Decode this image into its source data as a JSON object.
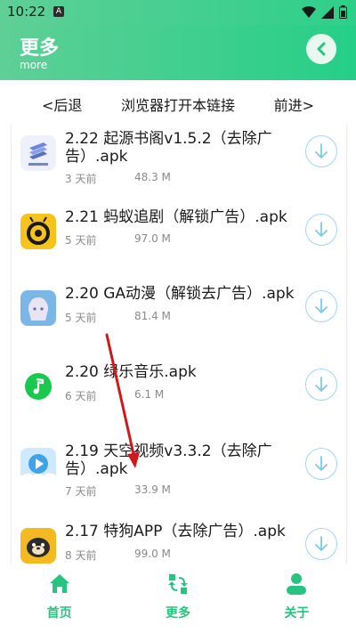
{
  "status_bar": {
    "time": "10:22",
    "notif_letter": "A"
  },
  "header": {
    "title": "更多",
    "subtitle": "more"
  },
  "browser_nav": {
    "back": "<后退",
    "open_link": "浏览器打开本链接",
    "forward": "前进>"
  },
  "apps": [
    {
      "title": "2.22 起源书阁v1.5.2（去除广告）.apk",
      "date": "3 天前",
      "size": "48.3 M",
      "icon": "book-stack-icon",
      "color": "#6e86d8"
    },
    {
      "title": "2.21 蚂蚁追剧（解锁广告）.apk",
      "date": "5 天前",
      "size": "97.0 M",
      "icon": "ant-icon",
      "color": "#f6c31c"
    },
    {
      "title": "2.20 GA动漫（解锁去广告）.apk",
      "date": "5 天前",
      "size": "81.4 M",
      "icon": "anime-girl-icon",
      "color": "#7ab7e6"
    },
    {
      "title": "2.20 绿乐音乐.apk",
      "date": "6 天前",
      "size": "6.1 M",
      "icon": "music-note-icon",
      "color": "#19c94d"
    },
    {
      "title": "2.19 天空视频v3.3.2（去除广告）.apk",
      "date": "7 天前",
      "size": "33.9 M",
      "icon": "play-cloud-icon",
      "color": "#3fa3ea"
    },
    {
      "title": "2.17 特狗APP（去除广告）.apk",
      "date": "8 天前",
      "size": "99.0 M",
      "icon": "dog-icon",
      "color": "#f5b921"
    }
  ],
  "tabs": [
    {
      "label": "首页",
      "icon": "home-icon"
    },
    {
      "label": "更多",
      "icon": "swap-icon"
    },
    {
      "label": "关于",
      "icon": "person-icon"
    }
  ],
  "colors": {
    "accent": "#27c480",
    "header": "#2ecf8a",
    "download_ring": "#9fd7ee",
    "annotation_arrow": "#d0191b"
  }
}
